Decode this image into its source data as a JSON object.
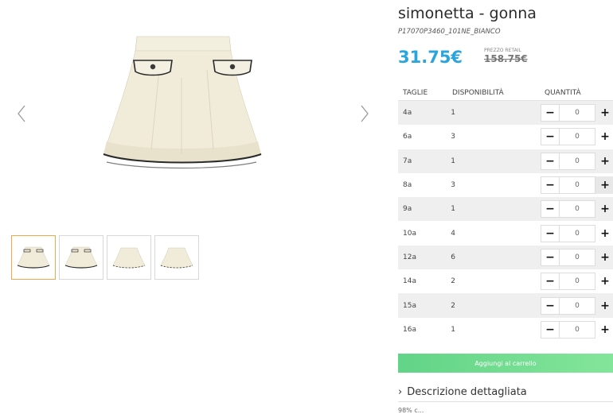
{
  "product": {
    "title": "simonetta - gonna",
    "sku": "P17070P3460_101NE_BIANCO",
    "price": "31.75€",
    "retail_label": "PREZZO RETAIL",
    "retail_price": "158.75€"
  },
  "gallery": {
    "prev_icon": "chevron-left-icon",
    "next_icon": "chevron-right-icon",
    "thumbnail_count": 4,
    "active_thumbnail": 1
  },
  "table": {
    "headers": {
      "size": "TAGLIE",
      "availability": "DISPONIBILITÀ",
      "quantity": "QUANTITÀ"
    },
    "rows": [
      {
        "size": "4a",
        "availability": "1",
        "quantity": "0"
      },
      {
        "size": "6a",
        "availability": "3",
        "quantity": "0"
      },
      {
        "size": "7a",
        "availability": "1",
        "quantity": "0"
      },
      {
        "size": "8a",
        "availability": "3",
        "quantity": "0"
      },
      {
        "size": "9a",
        "availability": "1",
        "quantity": "0"
      },
      {
        "size": "10a",
        "availability": "4",
        "quantity": "0"
      },
      {
        "size": "12a",
        "availability": "6",
        "quantity": "0"
      },
      {
        "size": "14a",
        "availability": "2",
        "quantity": "0"
      },
      {
        "size": "15a",
        "availability": "2",
        "quantity": "0"
      },
      {
        "size": "16a",
        "availability": "1",
        "quantity": "0"
      }
    ],
    "minus_symbol": "−",
    "plus_symbol": "+"
  },
  "actions": {
    "add_to_cart": "Aggiungi al carrello",
    "description_toggle": "Descrizione dettagliata",
    "description_chevron": "›"
  },
  "composition": "98% c...",
  "colors": {
    "price": "#2aa4dc",
    "cart_button": "#6fdc8f",
    "active_thumb_border": "#f0a94a",
    "skirt": "#f3efdf",
    "trim": "#2a2a2a"
  }
}
